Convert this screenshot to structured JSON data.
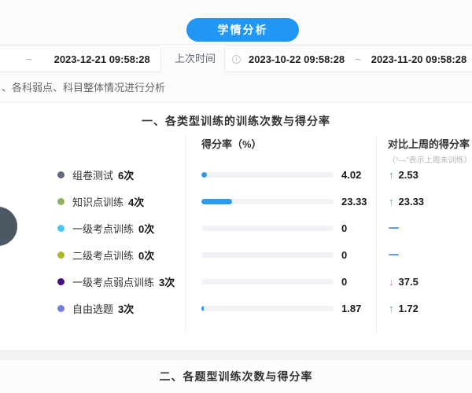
{
  "header": {
    "analyze_button": "学情分析",
    "current_range": {
      "separator": "~",
      "end_date": "2023-12-21 09:58:28"
    },
    "last_time_label": "上次时间",
    "last_range": {
      "start_date": "2023-10-22 09:58:28",
      "separator": "~",
      "end_date": "2023-11-20 09:58:28"
    },
    "description": "、各科弱点、科目整体情况进行分析"
  },
  "section1": {
    "title": "一、各类型训练的训练次数与得分率",
    "score_header": "得分率（%）",
    "compare_header": "对比上周的得分率",
    "compare_note": "（“—”表示上周未训练）",
    "rows": [
      {
        "label": "组卷测试",
        "count": "6次",
        "dot_color": "#5c6b7a",
        "value": 4.02,
        "value_label": "4.02",
        "trend": "up",
        "trend_label": "2.53"
      },
      {
        "label": "知识点训练",
        "count": "4次",
        "dot_color": "#8fb061",
        "value": 23.33,
        "value_label": "23.33",
        "trend": "up",
        "trend_label": "23.33"
      },
      {
        "label": "一级考点训练",
        "count": "0次",
        "dot_color": "#45c8f1",
        "value": 0,
        "value_label": "0",
        "trend": "none",
        "trend_label": ""
      },
      {
        "label": "二级考点训练",
        "count": "0次",
        "dot_color": "#a9b823",
        "value": 0,
        "value_label": "0",
        "trend": "none",
        "trend_label": ""
      },
      {
        "label": "一级考点弱点训练",
        "count": "3次",
        "dot_color": "#470d7f",
        "value": 0,
        "value_label": "0",
        "trend": "down",
        "trend_label": "37.5"
      },
      {
        "label": "自由选题",
        "count": "3次",
        "dot_color": "#7580df",
        "value": 1.87,
        "value_label": "1.87",
        "trend": "up",
        "trend_label": "1.72"
      }
    ],
    "axis_max": 100
  },
  "section2": {
    "title": "二、各题型训练次数与得分率"
  },
  "colors": {
    "accent_blue": "#2196f3",
    "bar_fill": "#2d9aed",
    "bar_track": "#f0f2f5",
    "trend_up": "#3cb179",
    "trend_down": "#e0705e",
    "trend_none_dash": "#64a0d8"
  }
}
